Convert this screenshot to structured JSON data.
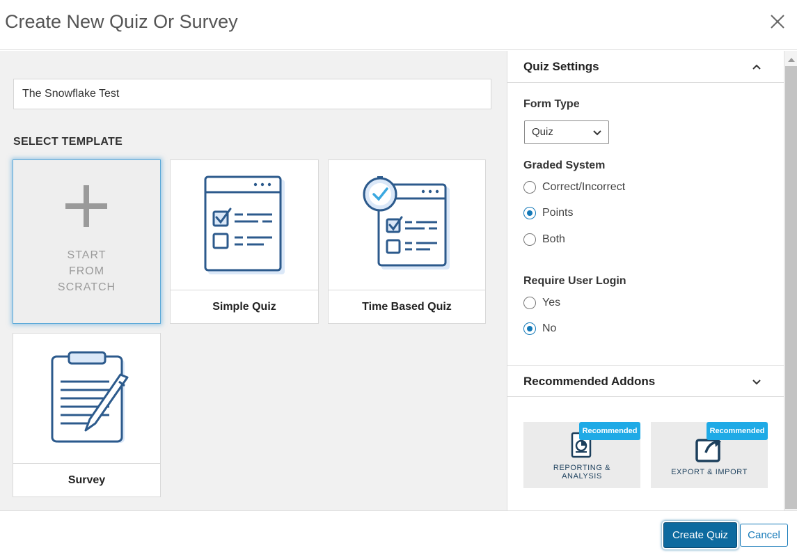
{
  "dialog": {
    "title": "Create New Quiz Or Survey"
  },
  "quiz_name": {
    "value": "The Snowflake Test"
  },
  "templates": {
    "section_label": "SELECT TEMPLATE",
    "scratch": {
      "line1": "START",
      "line2": "FROM",
      "line3": "SCRATCH"
    },
    "simple_quiz": "Simple Quiz",
    "time_based_quiz": "Time Based Quiz",
    "survey": "Survey"
  },
  "settings": {
    "title": "Quiz Settings",
    "form_type": {
      "label": "Form Type",
      "value": "Quiz"
    },
    "graded_system": {
      "label": "Graded System",
      "options": [
        "Correct/Incorrect",
        "Points",
        "Both"
      ],
      "selected": "Points"
    },
    "require_login": {
      "label": "Require User Login",
      "options": [
        "Yes",
        "No"
      ],
      "selected": "No"
    }
  },
  "addons": {
    "title": "Recommended Addons",
    "items": [
      {
        "line1": "REPORTING &",
        "line2": "ANALYSIS",
        "badge": "Recommended"
      },
      {
        "line1": "EXPORT & IMPORT",
        "badge": "Recommended"
      }
    ]
  },
  "footer": {
    "create_label": "Create Quiz",
    "cancel_label": "Cancel"
  },
  "colors": {
    "accent": "#0d6a9f",
    "icon_blue": "#2c5a8c",
    "icon_fill": "#dbe8f8",
    "badge": "#1faae6",
    "selection_glow": "#5aa8d8"
  }
}
